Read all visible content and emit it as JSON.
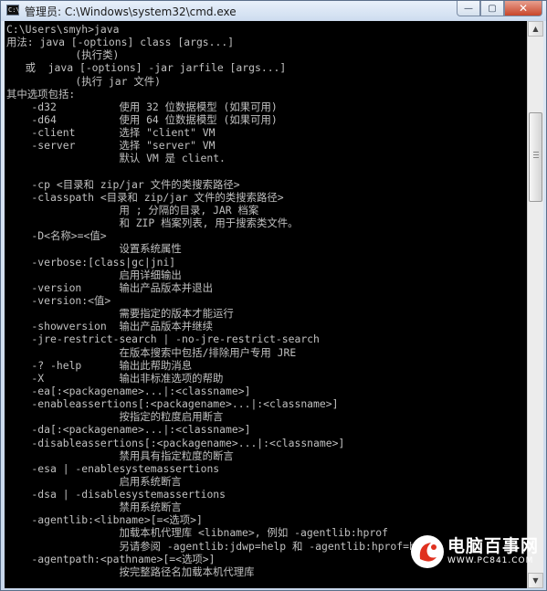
{
  "window": {
    "icon_glyph": "C:\\",
    "title": "管理员: C:\\Windows\\system32\\cmd.exe",
    "controls": {
      "minimize_glyph": "—",
      "maximize_glyph": "▢",
      "close_glyph": "✕"
    }
  },
  "console": {
    "lines": [
      "C:\\Users\\smyh>java",
      "用法: java [-options] class [args...]",
      "           (执行类)",
      "   或  java [-options] -jar jarfile [args...]",
      "           (执行 jar 文件)",
      "其中选项包括:",
      "    -d32          使用 32 位数据模型 (如果可用)",
      "    -d64          使用 64 位数据模型 (如果可用)",
      "    -client       选择 \"client\" VM",
      "    -server       选择 \"server\" VM",
      "                  默认 VM 是 client.",
      "",
      "    -cp <目录和 zip/jar 文件的类搜索路径>",
      "    -classpath <目录和 zip/jar 文件的类搜索路径>",
      "                  用 ; 分隔的目录, JAR 档案",
      "                  和 ZIP 档案列表, 用于搜索类文件。",
      "    -D<名称>=<值>",
      "                  设置系统属性",
      "    -verbose:[class|gc|jni]",
      "                  启用详细输出",
      "    -version      输出产品版本并退出",
      "    -version:<值>",
      "                  需要指定的版本才能运行",
      "    -showversion  输出产品版本并继续",
      "    -jre-restrict-search | -no-jre-restrict-search",
      "                  在版本搜索中包括/排除用户专用 JRE",
      "    -? -help      输出此帮助消息",
      "    -X            输出非标准选项的帮助",
      "    -ea[:<packagename>...|:<classname>]",
      "    -enableassertions[:<packagename>...|:<classname>]",
      "                  按指定的粒度启用断言",
      "    -da[:<packagename>...|:<classname>]",
      "    -disableassertions[:<packagename>...|:<classname>]",
      "                  禁用具有指定粒度的断言",
      "    -esa | -enablesystemassertions",
      "                  启用系统断言",
      "    -dsa | -disablesystemassertions",
      "                  禁用系统断言",
      "    -agentlib:<libname>[=<选项>]",
      "                  加载本机代理库 <libname>, 例如 -agentlib:hprof",
      "                  另请参阅 -agentlib:jdwp=help 和 -agentlib:hprof=help",
      "    -agentpath:<pathname>[=<选项>]",
      "                  按完整路径名加载本机代理库"
    ]
  },
  "scrollbar": {
    "up_glyph": "▲",
    "down_glyph": "▼"
  },
  "watermark": {
    "main": "电脑百事网",
    "sub": "WWW.PC841.COM"
  },
  "colors": {
    "console_bg": "#000000",
    "console_text": "#c0c0c0",
    "close_button": "#c8452a",
    "watermark_red": "#e0301e"
  }
}
